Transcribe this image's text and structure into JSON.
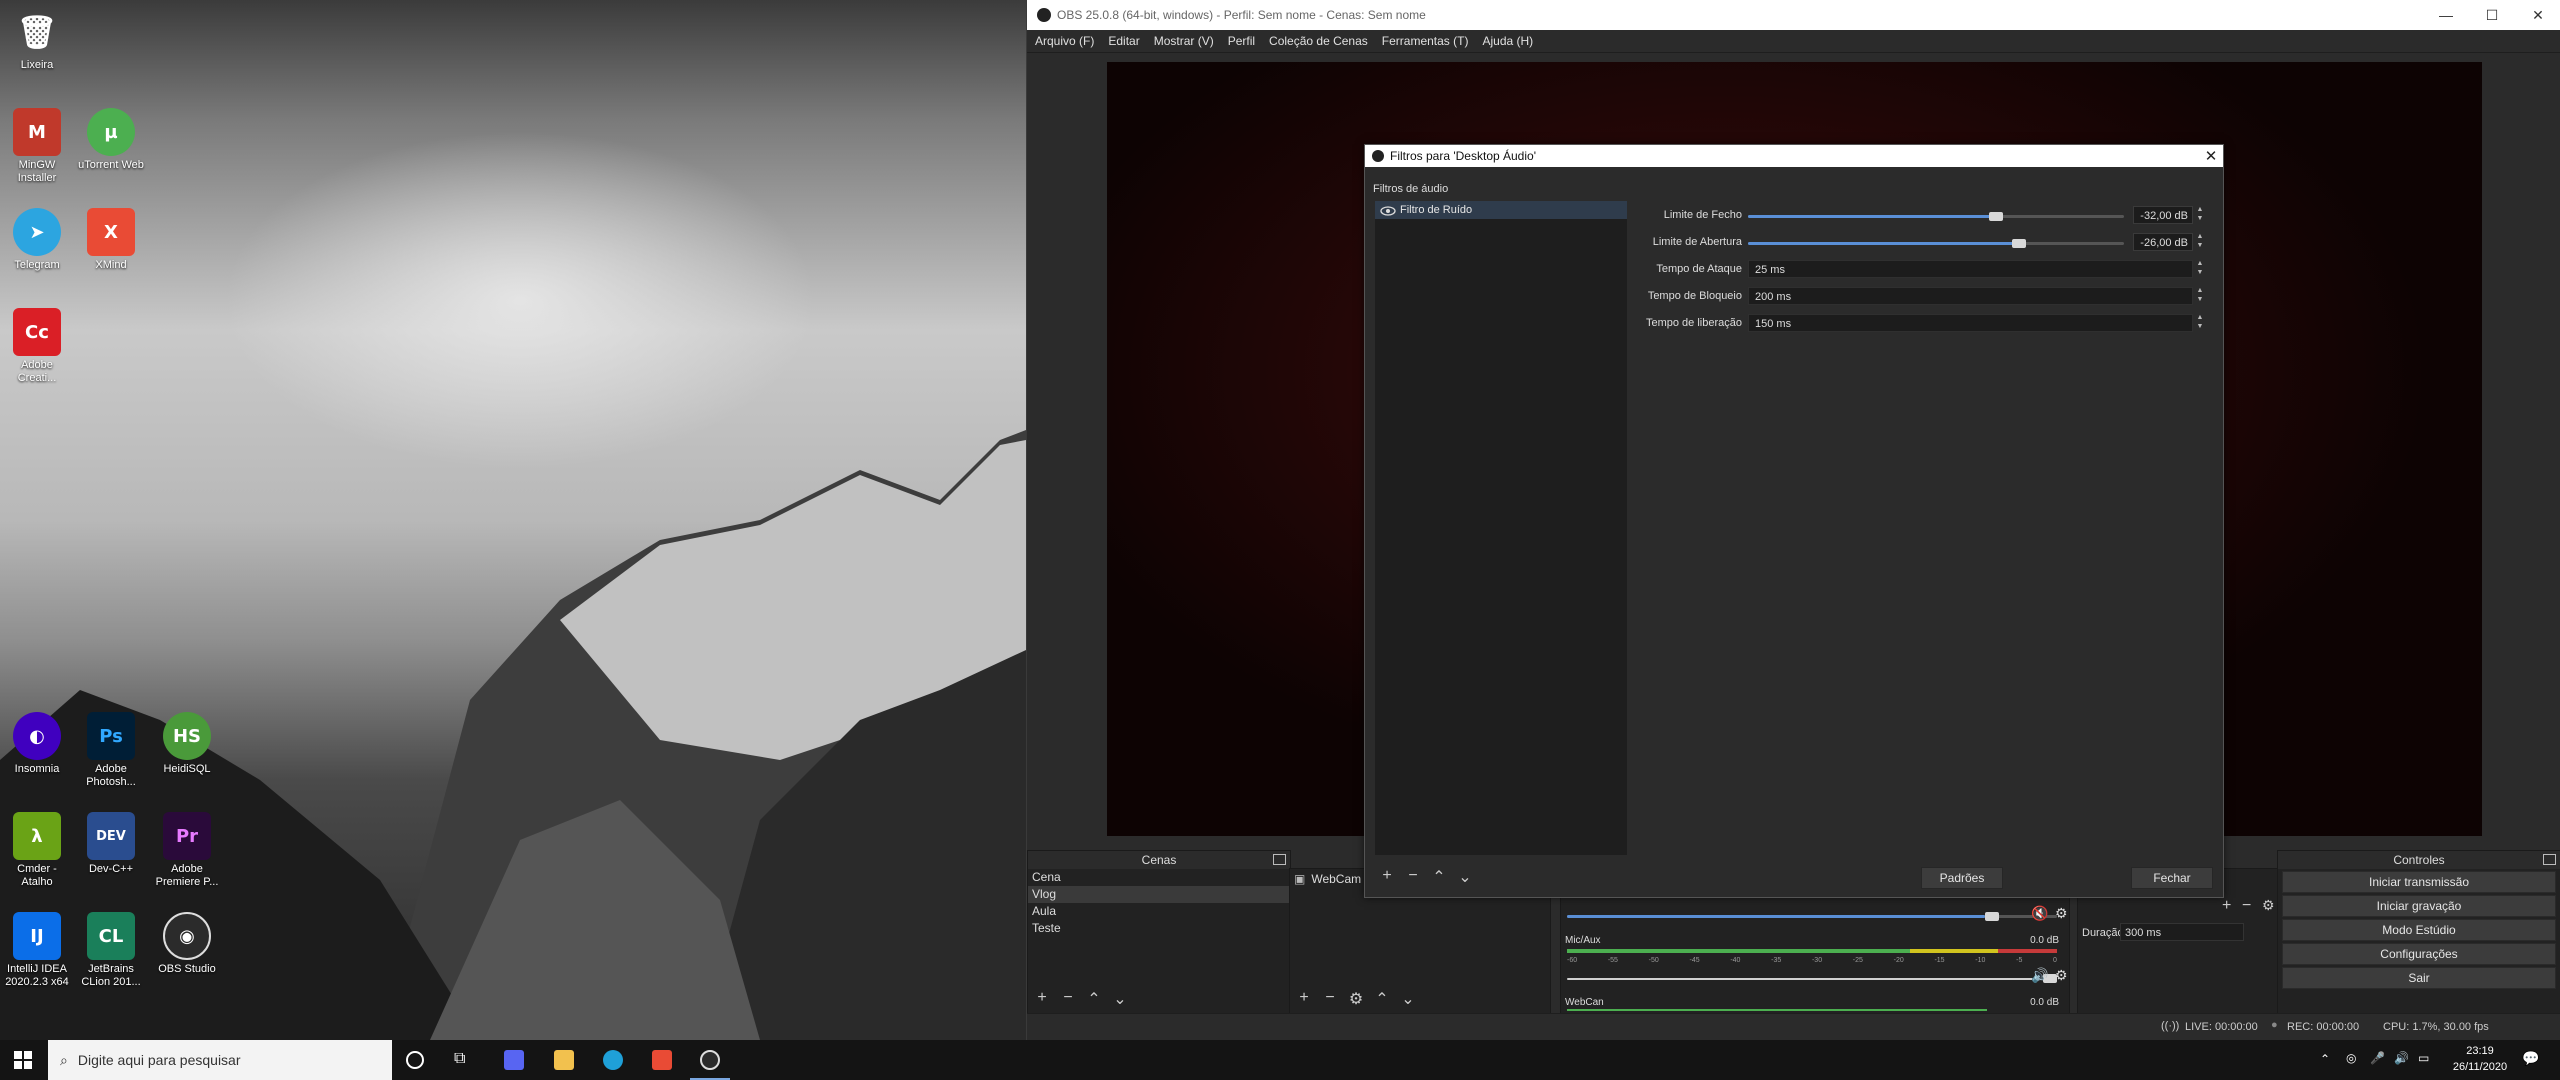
{
  "desktop": {
    "icons": [
      {
        "label": "Lixeira",
        "glyph": "🗑",
        "color": "#00000000"
      },
      {
        "label": "MinGW Installer",
        "glyph": "M",
        "color": "#c0392b"
      },
      {
        "label": "uTorrent Web",
        "glyph": "µ",
        "color": "#4caf50"
      },
      {
        "label": "Telegram",
        "glyph": "➤",
        "color": "#2ca5e0"
      },
      {
        "label": "XMind",
        "glyph": "X",
        "color": "#e94b35"
      },
      {
        "label": "Adobe Creati...",
        "glyph": "Cc",
        "color": "#da1f26"
      },
      {
        "label": "Insomnia",
        "glyph": "◐",
        "color": "#4000bf"
      },
      {
        "label": "Adobe Photosh...",
        "glyph": "Ps",
        "color": "#001e36"
      },
      {
        "label": "HeidiSQL",
        "glyph": "HS",
        "color": "#4a9a3a"
      },
      {
        "label": "Cmder - Atalho",
        "glyph": "λ",
        "color": "#6aa316"
      },
      {
        "label": "Dev-C++",
        "glyph": "DEV",
        "color": "#2a4d8f"
      },
      {
        "label": "Adobe Premiere P...",
        "glyph": "Pr",
        "color": "#2a0a3a"
      },
      {
        "label": "IntelliJ IDEA 2020.2.3 x64",
        "glyph": "IJ",
        "color": "#0b6ee8"
      },
      {
        "label": "JetBrains CLion 201...",
        "glyph": "CL",
        "color": "#21d789"
      },
      {
        "label": "OBS Studio",
        "glyph": "◉",
        "color": "#2b2b2b"
      }
    ]
  },
  "obs": {
    "window_title": "OBS 25.0.8 (64-bit, windows) - Perfil: Sem nome - Cenas: Sem nome",
    "menu": [
      "Arquivo (F)",
      "Editar",
      "Mostrar (V)",
      "Perfil",
      "Coleção de Cenas",
      "Ferramentas (T)",
      "Ajuda (H)"
    ],
    "scenes": {
      "title": "Cenas",
      "items": [
        "Cena",
        "Vlog",
        "Aula",
        "Teste"
      ],
      "selected": "Vlog"
    },
    "sources": {
      "items": [
        "WebCam"
      ]
    },
    "mixer": {
      "channels": [
        {
          "name": "Mic/Aux",
          "db": "0.0 dB"
        },
        {
          "name": "WebCan",
          "db": "0.0 dB"
        }
      ],
      "ticks": [
        "-60",
        "-55",
        "-50",
        "-45",
        "-40",
        "-35",
        "-30",
        "-25",
        "-20",
        "-15",
        "-10",
        "-5",
        "0"
      ]
    },
    "transitions": {
      "duration_label": "Duração",
      "duration_value": "300 ms"
    },
    "controls": {
      "title": "Controles",
      "buttons": [
        "Iniciar transmissão",
        "Iniciar gravação",
        "Modo Estúdio",
        "Configurações",
        "Sair"
      ]
    },
    "status": {
      "live": "LIVE: 00:00:00",
      "rec": "REC: 00:00:00",
      "cpu": "CPU: 1.7%, 30.00 fps"
    }
  },
  "dialog": {
    "title": "Filtros para 'Desktop Áudio'",
    "section_label": "Filtros de áudio",
    "filters": [
      "Filtro de Ruído"
    ],
    "props": {
      "close_threshold": {
        "label": "Limite de Fecho",
        "value": "-32,00 dB",
        "level": 0.66
      },
      "open_threshold": {
        "label": "Limite de Abertura",
        "value": "-26,00 dB",
        "level": 0.72
      },
      "attack": {
        "label": "Tempo de Ataque",
        "value": "25 ms"
      },
      "hold": {
        "label": "Tempo de Bloqueio",
        "value": "200 ms"
      },
      "release": {
        "label": "Tempo de liberação",
        "value": "150 ms"
      }
    },
    "defaults_button": "Padrões",
    "close_button": "Fechar"
  },
  "taskbar": {
    "search_placeholder": "Digite aqui para pesquisar",
    "time": "23:19",
    "date": "26/11/2020"
  }
}
